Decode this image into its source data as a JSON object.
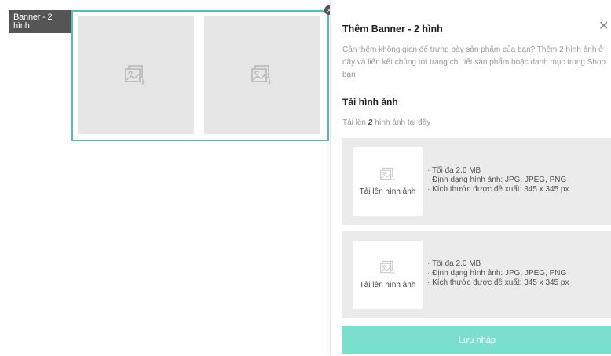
{
  "canvas": {
    "banner_tag": "Banner - 2 hình",
    "slots": [
      {
        "icon": "image-placeholder-icon"
      },
      {
        "icon": "image-placeholder-icon"
      }
    ],
    "frame_color": "#4fc3b3"
  },
  "panel": {
    "title": "Thêm Banner - 2 hình",
    "close_icon": "close-icon",
    "description": "Cần thêm không gian để trưng bày sản phẩm của bạn? Thêm 2 hình ảnh ở đây và liên kết chúng tới trang chi tiết sản phẩm hoặc danh mục trong Shop bạn",
    "upload_section": {
      "title": "Tải hình ảnh",
      "sub_prefix": "Tải lên ",
      "sub_count": "2",
      "sub_suffix": " hình ảnh tại đây"
    },
    "uploads": [
      {
        "label": "Tải lên hình ảnh",
        "info": [
          "Tối đa 2.0 MB",
          "Định dạng hình ảnh: JPG, JPEG, PNG",
          "Kích thước được đề xuất: 345 x 345 px"
        ]
      },
      {
        "label": "Tải lên hình ảnh",
        "info": [
          "Tối đa 2.0 MB",
          "Định dạng hình ảnh: JPG, JPEG, PNG",
          "Kích thước được đề xuất: 345 x 345 px"
        ]
      }
    ],
    "save_label": "Lưu nháp",
    "accent_color": "#7adfcf"
  }
}
